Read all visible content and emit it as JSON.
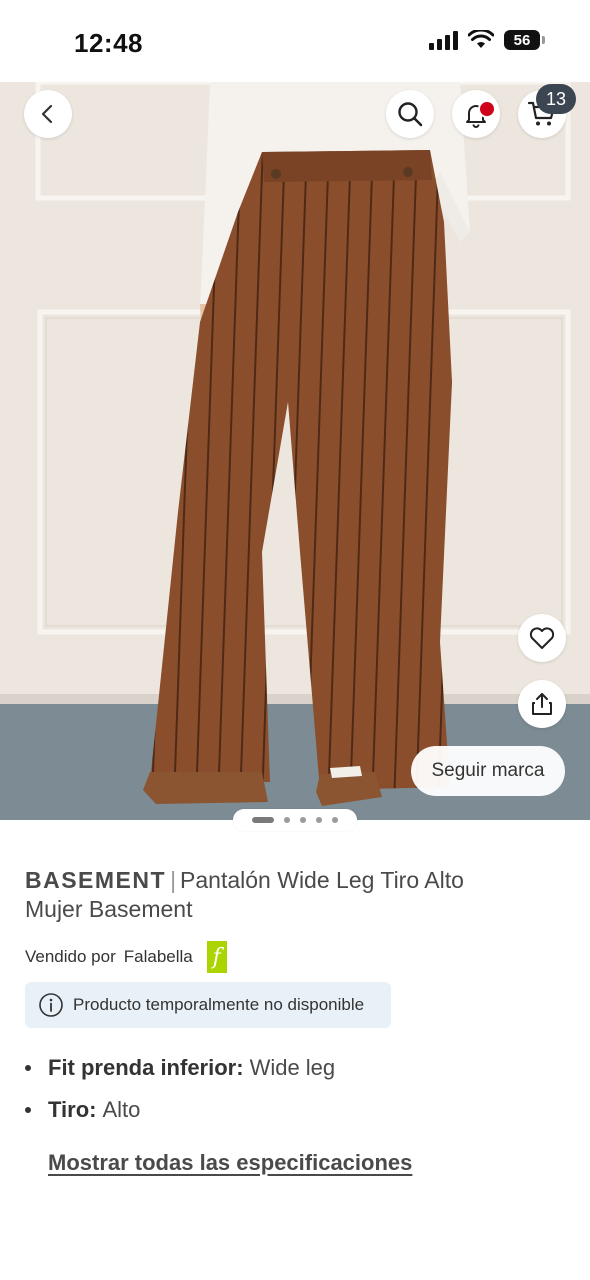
{
  "status_bar": {
    "time": "12:48",
    "battery": "56",
    "icons": [
      "signal-icon",
      "wifi-icon",
      "battery-icon"
    ]
  },
  "image_overlay": {
    "icons": [
      "back-icon",
      "search-icon",
      "bell-icon",
      "cart-icon",
      "heart-icon",
      "share-icon"
    ],
    "cart_count": "13",
    "follow_brand_label": "Seguir marca",
    "carousel": {
      "total": 5,
      "active_index": 0
    }
  },
  "product": {
    "brand": "BASEMENT",
    "separator": "|",
    "name_line1": "Pantalón Wide Leg Tiro Alto",
    "name_line2": "Mujer Basement",
    "seller_label": "Vendido por",
    "seller_name": "Falabella",
    "seller_logo_letter": "f",
    "availability": "Producto temporalmente no disponible",
    "specs": [
      {
        "label": "Fit prenda inferior:",
        "value": "Wide leg"
      },
      {
        "label": "Tiro:",
        "value": "Alto"
      }
    ],
    "show_all_specs": "Mostrar todas las especificaciones"
  },
  "colors": {
    "notification_dot": "#d0021b",
    "seller_logo": "#aad500",
    "alert_background": "#e8f1f8",
    "pants": "#8a4e2c"
  }
}
